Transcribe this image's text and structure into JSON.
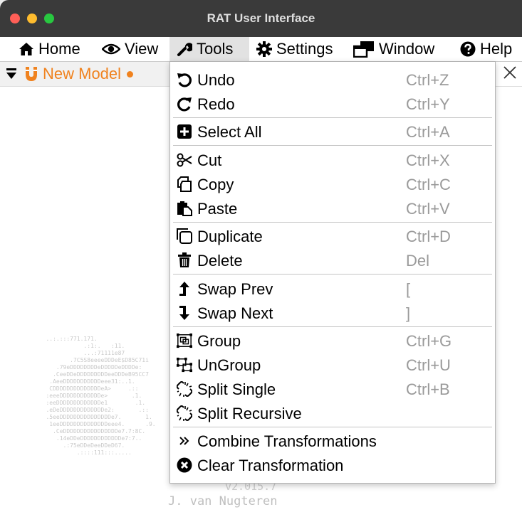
{
  "window": {
    "title": "RAT User Interface"
  },
  "menubar": [
    {
      "label": "Home",
      "icon": "home-icon"
    },
    {
      "label": "View",
      "icon": "eye-icon"
    },
    {
      "label": "Tools",
      "icon": "wrench-icon"
    },
    {
      "label": "Settings",
      "icon": "gear-icon"
    },
    {
      "label": "Window",
      "icon": "window-restore-icon"
    },
    {
      "label": "Help",
      "icon": "help-circle-icon"
    }
  ],
  "tab": {
    "label": "New Model",
    "close": "×"
  },
  "tools_menu": {
    "items": [
      {
        "label": "Undo",
        "shortcut": "Ctrl+Z",
        "icon": "undo-icon"
      },
      {
        "label": "Redo",
        "shortcut": "Ctrl+Y",
        "icon": "redo-icon"
      },
      {
        "label": "Select All",
        "shortcut": "Ctrl+A",
        "icon": "plus-square-icon"
      },
      {
        "label": "Cut",
        "shortcut": "Ctrl+X",
        "icon": "scissors-icon"
      },
      {
        "label": "Copy",
        "shortcut": "Ctrl+C",
        "icon": "copy-icon"
      },
      {
        "label": "Paste",
        "shortcut": "Ctrl+V",
        "icon": "paste-icon"
      },
      {
        "label": "Duplicate",
        "shortcut": "Ctrl+D",
        "icon": "duplicate-icon"
      },
      {
        "label": "Delete",
        "shortcut": "Del",
        "icon": "trash-icon"
      },
      {
        "label": "Swap Prev",
        "shortcut": "[",
        "icon": "arrow-up-icon"
      },
      {
        "label": "Swap Next",
        "shortcut": "]",
        "icon": "arrow-down-icon"
      },
      {
        "label": "Group",
        "shortcut": "Ctrl+G",
        "icon": "group-icon"
      },
      {
        "label": "UnGroup",
        "shortcut": "Ctrl+U",
        "icon": "ungroup-icon"
      },
      {
        "label": "Split Single",
        "shortcut": "Ctrl+B",
        "icon": "split-link-icon"
      },
      {
        "label": "Split Recursive",
        "shortcut": "",
        "icon": "split-link-icon"
      },
      {
        "label": "Combine Transformations",
        "shortcut": "",
        "icon": "double-chevron-right-icon"
      },
      {
        "label": "Clear Transformation",
        "shortcut": "",
        "icon": "times-circle-icon"
      }
    ]
  },
  "splash": {
    "ascii": "   ..:.:::771.171.\n              .:1:.   :11.\n              ...:71111e87\n          .7C5S8eeeeDDDeE$D85C71i\n      .79eDDDDDDDDeDDDDDeDDDDe:\n     .CeeDDeDDDDDDDDDeeDDDeB95CC7\n    .AeeDDDDDDDDDDDeee31:..1.\n    CDDDDDDDDDDDDDDeA>     .::\n   :eeeDDDDDDDDDDDDe>       .1.\n   :eeDDDDDDDDDDDDDe1        .1.\n   .eDeDDDDDDDDDDDDDe2:       .::\n   .5eeDDDDDDDDDDDDDDDe7.       1.\n    1eeDDDDDDDDDDDDDDeee4.      .9.\n     .CeDDDDDDDDDDDDDDDDe7.7:8C.\n      .14eDDeDDDDDDDDDDDDe7:7..\n        .:75eDDeDeeDDeD67.\n            .::::111:::.....",
    "version": "v2.015.7",
    "author": "J. van Nugteren"
  },
  "colors": {
    "accent": "#f0821e",
    "titlebar": "#3a3a3a"
  }
}
